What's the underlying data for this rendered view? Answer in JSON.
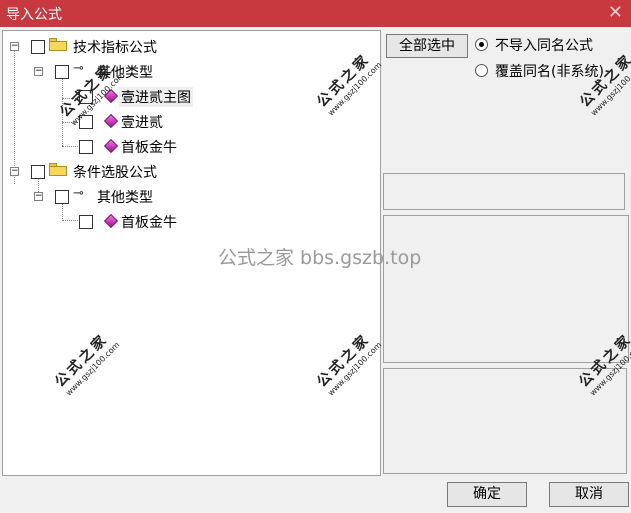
{
  "window": {
    "title": "导入公式",
    "close_glyph": "✕"
  },
  "tree": {
    "groups": [
      {
        "label": "技术指标公式",
        "category": "其他类型",
        "items": [
          "壹进贰主图",
          "壹进贰",
          "首板金牛"
        ],
        "selected_item": "壹进贰主图"
      },
      {
        "label": "条件选股公式",
        "category": "其他类型",
        "items": [
          "首板金牛"
        ]
      }
    ],
    "expander_glyph": "−"
  },
  "options": {
    "select_all_label": "全部选中",
    "radio_skip_label": "不导入同名公式",
    "radio_overwrite_label": "覆盖同名(非系统)",
    "selected_radio": "不导入同名公式"
  },
  "footer": {
    "ok_label": "确定",
    "cancel_label": "取消"
  },
  "watermarks": {
    "center_text": "公式之家 bbs.gszb.top",
    "stamp_title": "公式之家",
    "stamp_url": "www.gszj100.com"
  }
}
